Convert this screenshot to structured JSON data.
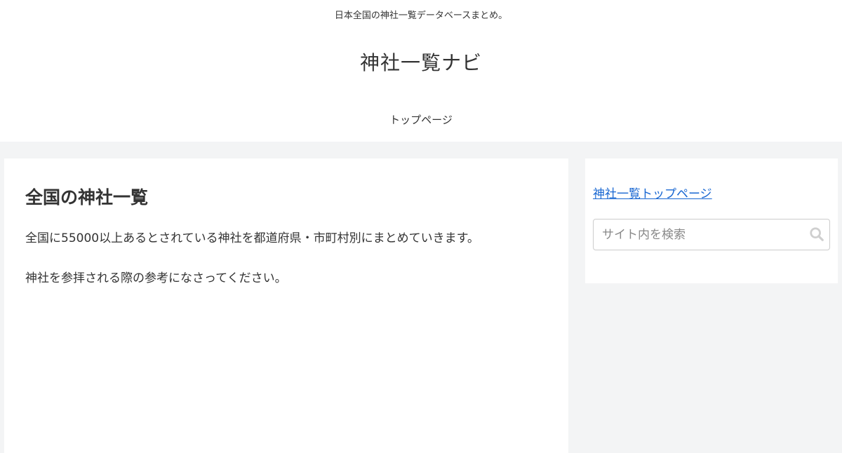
{
  "header": {
    "tagline": "日本全国の神社一覧データベースまとめ。",
    "site_title": "神社一覧ナビ",
    "nav": [
      "トップページ"
    ]
  },
  "main": {
    "title": "全国の神社一覧",
    "paragraphs": [
      "全国に55000以上あるとされている神社を都道府県・市町村別にまとめていきます。",
      "神社を参拝される際の参考になさってください。"
    ]
  },
  "sidebar": {
    "link_label": "神社一覧トップページ",
    "search_placeholder": "サイト内を検索",
    "search_icon": "search-icon"
  },
  "colors": {
    "background": "#f3f4f5",
    "link": "#1967d2",
    "text": "#333333"
  }
}
